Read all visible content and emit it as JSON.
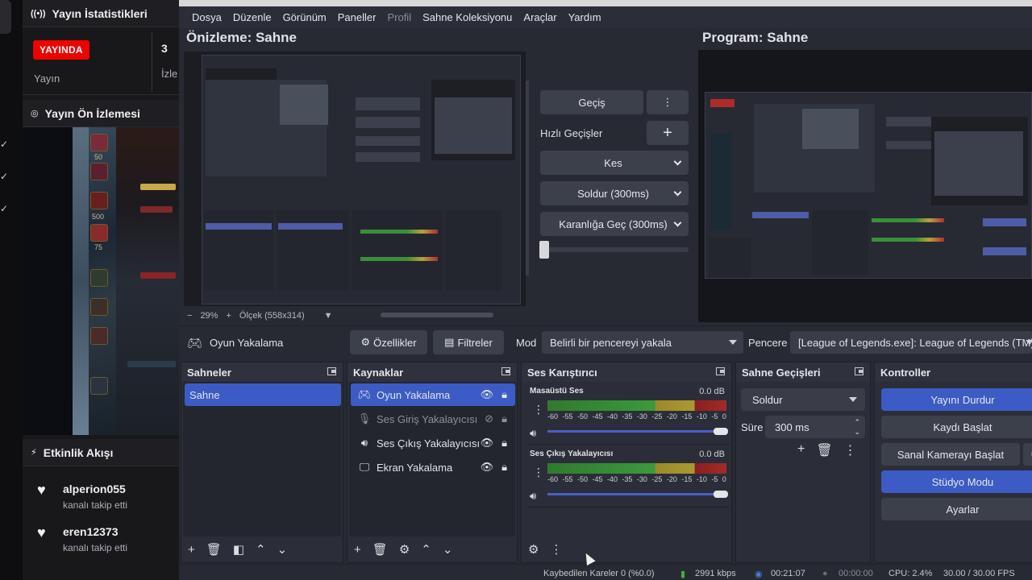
{
  "dashboard": {
    "stats_title": "Yayın İstatistikleri",
    "live_badge": "YAYINDA",
    "stream_label": "Yayın",
    "viewers_count": "3",
    "viewers_label_partial": "İzle",
    "preview_title": "Yayın Ön İzlemesi",
    "game_numbers": [
      "50",
      "500",
      "75"
    ],
    "activity_title": "Etkinlik Akışı",
    "activity": [
      {
        "user": "alperion055",
        "action": "kanalı takip etti"
      },
      {
        "user": "eren12373",
        "action": "kanalı takip etti"
      }
    ]
  },
  "obs": {
    "menu": [
      {
        "label": "Dosya",
        "disabled": false
      },
      {
        "label": "Düzenle",
        "disabled": false
      },
      {
        "label": "Görünüm",
        "disabled": false
      },
      {
        "label": "Paneller",
        "disabled": false
      },
      {
        "label": "Profil",
        "disabled": true
      },
      {
        "label": "Sahne Koleksiyonu",
        "disabled": false
      },
      {
        "label": "Araçlar",
        "disabled": false
      },
      {
        "label": "Yardım",
        "disabled": false
      }
    ],
    "preview_title": "Önizleme: Sahne",
    "program_title": "Program: Sahne",
    "zoom": {
      "percent": "29%",
      "plus": "+",
      "scale": "Ölçek (558x314)"
    },
    "transition": {
      "label": "Geçiş",
      "quick_label": "Hızlı Geçişler",
      "cut": "Kes",
      "fade": "Soldur (300ms)",
      "fade_black": "Karanlığa Geç (300ms)"
    },
    "source_toolbar": {
      "source_name": "Oyun Yakalama",
      "properties": "Özellikler",
      "filters": "Filtreler",
      "mode_label": "Mod",
      "mode_value": "Belirli bir pencereyi yakala",
      "window_label": "Pencere",
      "window_value": "[League of Legends.exe]: League of Legends (TM)"
    },
    "scenes": {
      "title": "Sahneler",
      "items": [
        "Sahne"
      ]
    },
    "sources": {
      "title": "Kaynaklar",
      "items": [
        {
          "label": "Oyun Yakalama",
          "icon": "gamepad-icon",
          "selected": true,
          "dimmed": false
        },
        {
          "label": "Ses Giriş Yakalayıcısı",
          "icon": "microphone-icon",
          "selected": false,
          "dimmed": true
        },
        {
          "label": "Ses Çıkış Yakalayıcısı",
          "icon": "speaker-icon",
          "selected": false,
          "dimmed": false
        },
        {
          "label": "Ekran Yakalama",
          "icon": "monitor-icon",
          "selected": false,
          "dimmed": false
        }
      ]
    },
    "mixer": {
      "title": "Ses Karıştırıcı",
      "scale": [
        "-60",
        "-55",
        "-50",
        "-45",
        "-40",
        "-35",
        "-30",
        "-25",
        "-20",
        "-15",
        "-10",
        "-5",
        "0"
      ],
      "channels": [
        {
          "name": "Masaüstü Ses",
          "db": "0.0 dB",
          "volume": 1.0
        },
        {
          "name": "Ses Çıkış Yakalayıcısı",
          "db": "0.0 dB",
          "volume": 1.0
        }
      ]
    },
    "scene_transitions": {
      "title": "Sahne Geçişleri",
      "type": "Soldur",
      "duration_label": "Süre",
      "duration_value": "300 ms"
    },
    "controls": {
      "title": "Kontroller",
      "stop_stream": "Yayını Durdur",
      "start_record": "Kaydı Başlat",
      "virtual_cam": "Sanal Kamerayı Başlat",
      "studio_mode": "Stüdyo Modu",
      "settings": "Ayarlar"
    },
    "status": {
      "dropped": "Kaybedilen Kareler 0 (%0.0)",
      "bitrate": "2991 kbps",
      "stream_time": "00:21:07",
      "record_time": "00:00:00",
      "cpu": "CPU: 2.4%",
      "fps": "30.00 / 30.00 FPS"
    }
  },
  "colors": {
    "accent_blue": "#3c5bc4",
    "live_red": "#eb0400",
    "panel_bg": "#2b2e38"
  }
}
